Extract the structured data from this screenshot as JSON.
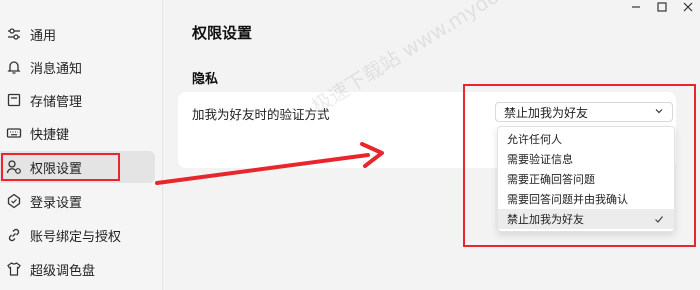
{
  "sidebar": {
    "items": [
      {
        "label": "通用",
        "icon": "sliders-icon"
      },
      {
        "label": "消息通知",
        "icon": "bell-icon"
      },
      {
        "label": "存储管理",
        "icon": "storage-icon"
      },
      {
        "label": "快捷键",
        "icon": "keyboard-icon"
      },
      {
        "label": "权限设置",
        "icon": "user-lock-icon",
        "active": true
      },
      {
        "label": "登录设置",
        "icon": "shield-icon"
      },
      {
        "label": "账号绑定与授权",
        "icon": "link-icon"
      },
      {
        "label": "超级调色盘",
        "icon": "shirt-icon"
      }
    ]
  },
  "main": {
    "title": "权限设置",
    "section": "隐私",
    "row_label": "加我为好友时的验证方式",
    "select_value": "禁止加我为好友",
    "options": [
      {
        "label": "允许任何人"
      },
      {
        "label": "需要验证信息"
      },
      {
        "label": "需要正确回答问题"
      },
      {
        "label": "需要回答问题并由我确认"
      },
      {
        "label": "禁止加我为好友",
        "selected": true
      }
    ]
  },
  "watermark": "极速下载站 www.mydown.com",
  "colors": {
    "highlight": "#e8262b",
    "background": "#f3f3f3",
    "card": "#ffffff"
  }
}
